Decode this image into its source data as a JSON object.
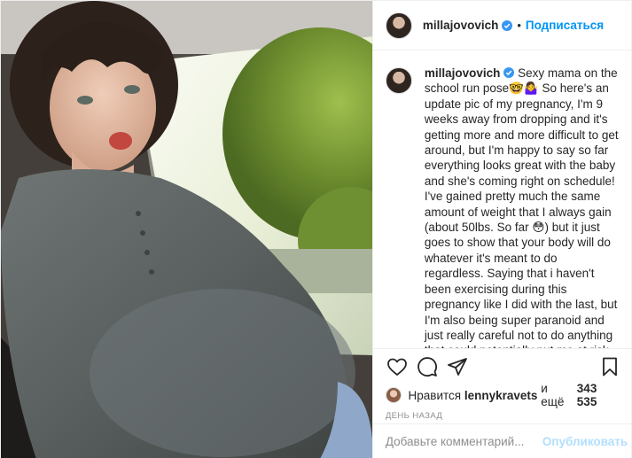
{
  "post": {
    "username": "millajovovich",
    "follow_label": "Подписаться",
    "caption": {
      "username": "millajovovich",
      "text": " Sexy mama on the school run pose🤓🤷‍♀️ So here's an update pic of my pregnancy, I'm 9 weeks away from dropping and it's getting more and more difficult to get around, but I'm happy to say so far everything looks great with the baby and she's coming right on schedule! I've gained pretty much the same amount of weight that I always gain (about 50lbs. So far 😳) but it just goes to show that your body will do whatever it's meant to do regardless. Saying that i haven't been exercising during this pregnancy like I did with the last, but I'm also being super paranoid and just really careful not to do anything that could potentially put me at risk of miscarriage. Anyway, the plus side is my mama boobs are back"
    },
    "likes": {
      "prefix": "Нравится",
      "user": "lennykravets",
      "connector": "и ещё",
      "count": "343 535"
    },
    "timestamp": "День назад",
    "comment_placeholder": "Добавьте комментарий...",
    "publish_label": "Опубликовать"
  },
  "icons": {
    "verified": "verified-badge-icon",
    "like": "heart-icon",
    "comment": "comment-bubble-icon",
    "share": "paper-plane-icon",
    "save": "bookmark-icon"
  },
  "colors": {
    "accent": "#0095f6",
    "publish_disabled": "#b2dffc",
    "secondary_text": "#8e8e8e",
    "border": "#efefef"
  }
}
